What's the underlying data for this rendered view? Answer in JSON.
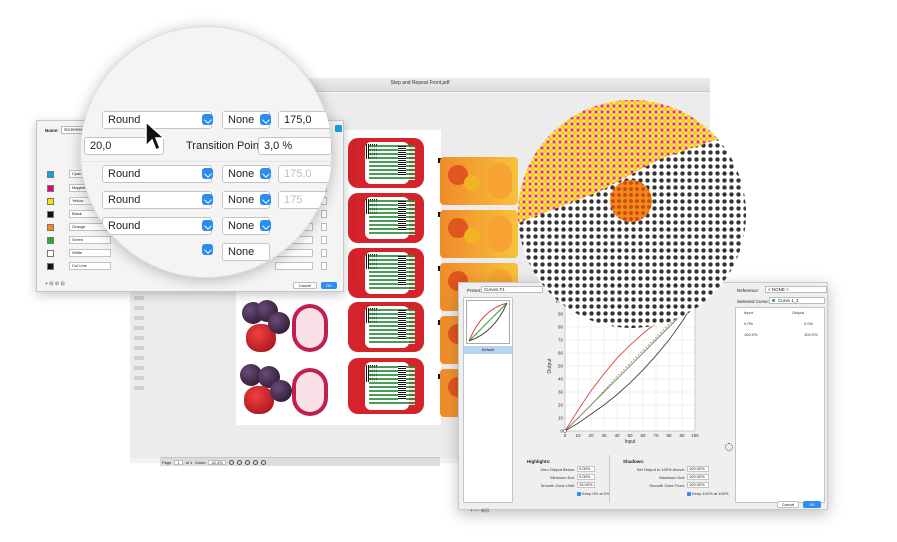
{
  "app": {
    "title": "Step and Repeat Front.pdf"
  },
  "screening_dialog": {
    "name_label": "Name:",
    "name_value": "Screensett",
    "rows": [
      {
        "color": "#1a9ee0",
        "name": "Cyan",
        "shape": "Round",
        "shape2": "None"
      },
      {
        "color": "#e6007e",
        "name": "Magenta",
        "shape": "Round",
        "shape2": "None"
      },
      {
        "color": "#ffe000",
        "name": "Yellow",
        "shape": "Round",
        "shape2": "None"
      },
      {
        "color": "#111111",
        "name": "Black",
        "shape": "Round",
        "shape2": "None"
      },
      {
        "color": "#f08a1c",
        "name": "Orange",
        "shape": "Round",
        "shape2": "None"
      },
      {
        "color": "#2aa83c",
        "name": "Green",
        "shape": "Round",
        "shape2": "None"
      },
      {
        "color": "#ffffff",
        "name": "White",
        "shape": "Round",
        "shape2": "None"
      },
      {
        "color": "#111111",
        "name": "Cut Line",
        "shape": "Round",
        "shape2": "None"
      }
    ],
    "bottom_tools": "+ ⊟  ⊘ ⊟",
    "cancel": "Cancel",
    "ok": "OK"
  },
  "magnifier": {
    "row1": {
      "shape": "Round",
      "shape2": "None",
      "value": "175,0"
    },
    "row2": {
      "value": "20,0",
      "label": "Transition Point:",
      "value2": "3,0 %"
    },
    "row3": {
      "shape": "Round",
      "shape2": "None",
      "value": "175,0"
    },
    "row4": {
      "shape": "Round",
      "shape2": "None",
      "value": "175"
    },
    "row5": {
      "shape": "Round",
      "shape2": "None"
    },
    "row6": {
      "shape2": "None"
    }
  },
  "statusbar": {
    "page_label": "Page",
    "page_value": "1",
    "of": "of 1",
    "zoom_label": "Zoom",
    "zoom_value": "42.3%"
  },
  "curve_dialog": {
    "preset_label": "Preset:",
    "preset_value": "Curves F1",
    "type_label": "Type:",
    "type_value": "Output",
    "reference_label": "Reference:",
    "reference_value": "< NONE >",
    "selected_label": "Selected Curve:",
    "selected_value": "Curve 1_1",
    "list_item": "Default",
    "list_tools": "+  —  ⊕⊟",
    "table_headers": [
      "Input",
      "Output"
    ],
    "table_rows": [
      [
        "0.0%",
        "0.0%"
      ],
      [
        "100.0%",
        "100.0%"
      ]
    ],
    "highlights": {
      "title": "Highlights:",
      "fields": [
        {
          "label": "Zero Output Below:",
          "value": "0.00%"
        },
        {
          "label": "Minimum Dot:",
          "value": "0.00%"
        },
        {
          "label": "Smooth Zone Until:",
          "value": "15.00%"
        }
      ],
      "checkbox": "Keep 0% at 0%"
    },
    "shadows": {
      "title": "Shadows:",
      "fields": [
        {
          "label": "Set Output to 100% Above:",
          "value": "100.00%"
        },
        {
          "label": "Maximum Dot:",
          "value": "100.00%"
        },
        {
          "label": "Smooth Zone From:",
          "value": "100.00%"
        }
      ],
      "checkbox": "Keep 100% at 100%"
    },
    "cancel": "Cancel",
    "ok": "OK"
  },
  "chart_data": {
    "type": "line",
    "xlabel": "Input",
    "ylabel": "Output",
    "xlim": [
      0,
      100
    ],
    "ylim": [
      0,
      100
    ],
    "x_ticks": [
      0,
      10,
      20,
      30,
      40,
      50,
      60,
      70,
      80,
      90,
      100
    ],
    "y_ticks": [
      0,
      10,
      20,
      30,
      40,
      50,
      60,
      70,
      80,
      90,
      100
    ],
    "grid": true,
    "series": [
      {
        "color": "#e0434a",
        "x": [
          0,
          10,
          20,
          30,
          40,
          50,
          60,
          70,
          80,
          90,
          100
        ],
        "y": [
          0,
          16,
          31,
          44,
          56,
          66,
          75,
          83,
          90,
          96,
          100
        ]
      },
      {
        "color": "#2aa83c",
        "x": [
          0,
          100
        ],
        "y": [
          0,
          100
        ]
      },
      {
        "color": "#444444",
        "x": [
          0,
          10,
          20,
          30,
          40,
          50,
          60,
          70,
          80,
          90,
          100
        ],
        "y": [
          0,
          6,
          13,
          20,
          28,
          37,
          47,
          58,
          70,
          84,
          100
        ]
      },
      {
        "color": "#f07080",
        "dashed": true,
        "x": [
          0,
          10,
          20,
          30,
          40,
          50,
          60,
          70,
          80,
          90,
          100
        ],
        "y": [
          0,
          10,
          20,
          31,
          42,
          52,
          62,
          72,
          82,
          91,
          100
        ]
      }
    ]
  }
}
